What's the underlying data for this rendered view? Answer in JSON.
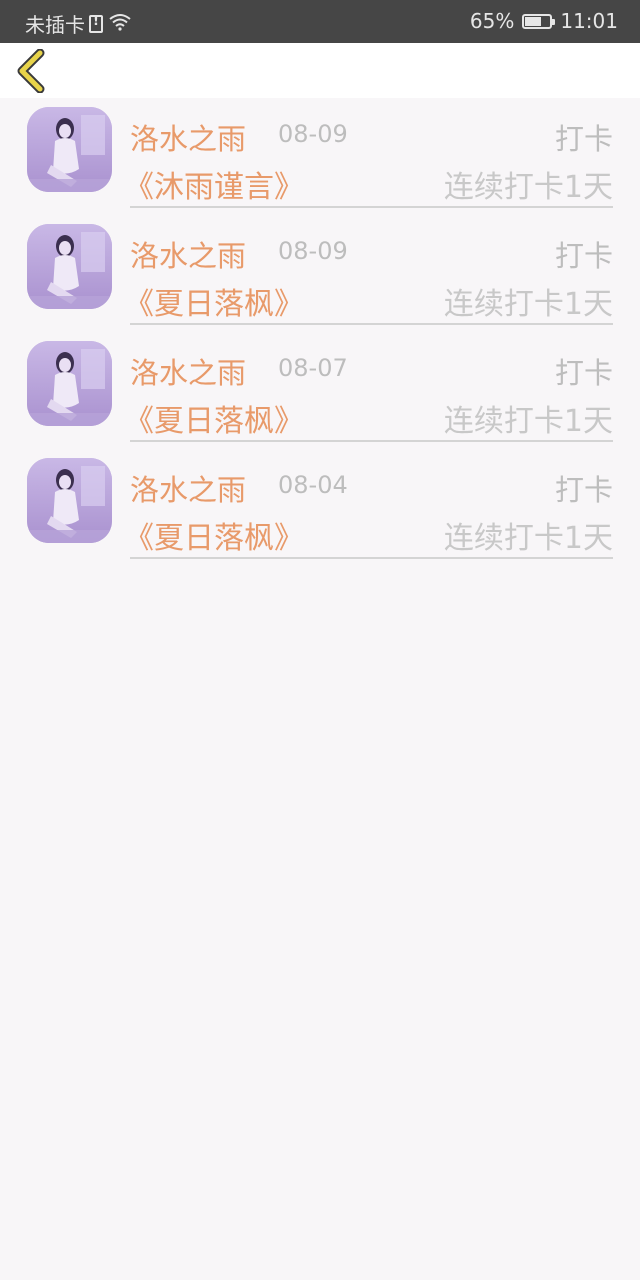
{
  "status_bar": {
    "carrier": "未插卡",
    "battery": "65%",
    "battery_level": 0.65,
    "time": "11:01"
  },
  "nav": {
    "back_icon": "chevron-left-icon",
    "accent": "#e8d44a"
  },
  "records": [
    {
      "name": "洛水之雨",
      "date": "08-09",
      "action": "打卡",
      "book": "《沐雨谨言》",
      "streak": "连续打卡1天"
    },
    {
      "name": "洛水之雨",
      "date": "08-09",
      "action": "打卡",
      "book": "《夏日落枫》",
      "streak": "连续打卡1天"
    },
    {
      "name": "洛水之雨",
      "date": "08-07",
      "action": "打卡",
      "book": "《夏日落枫》",
      "streak": "连续打卡1天"
    },
    {
      "name": "洛水之雨",
      "date": "08-04",
      "action": "打卡",
      "book": "《夏日落枫》",
      "streak": "连续打卡1天"
    }
  ],
  "colors": {
    "name": "#e89a6a",
    "meta": "#bdbdbd",
    "avatar_bg": "#b8a4d6"
  }
}
